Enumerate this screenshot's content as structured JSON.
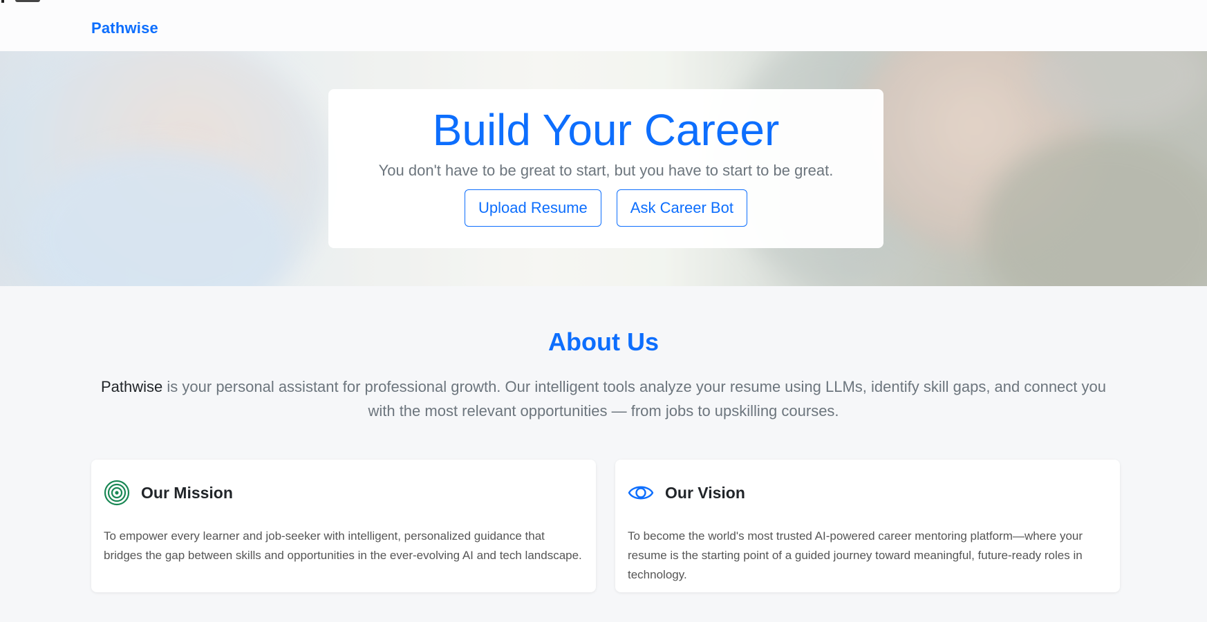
{
  "navbar": {
    "brand": "Pathwise"
  },
  "hero": {
    "title": "Build Your Career",
    "subtitle": "You don't have to be great to start, but you have to start to be great.",
    "upload_label": "Upload Resume",
    "bot_label": "Ask Career Bot"
  },
  "about": {
    "title": "About Us",
    "brand": "Pathwise",
    "text": "is your personal assistant for professional growth. Our intelligent tools analyze your resume using LLMs, identify skill gaps, and connect you with the most relevant opportunities — from jobs to upskilling courses."
  },
  "cards": [
    {
      "title": "Our Mission",
      "icon": "target-icon",
      "icon_color": "#198754",
      "text": "To empower every learner and job-seeker with intelligent, personalized guidance that bridges the gap between skills and opportunities in the ever-evolving AI and tech landscape."
    },
    {
      "title": "Our Vision",
      "icon": "eye-icon",
      "icon_color": "#0d6efd",
      "text": "To become the world's most trusted AI-powered career mentoring platform—where your resume is the starting point of a guided journey toward meaningful, future-ready roles in technology."
    }
  ],
  "colors": {
    "primary": "#0d6efd",
    "muted": "#6c757d",
    "success": "#198754"
  }
}
